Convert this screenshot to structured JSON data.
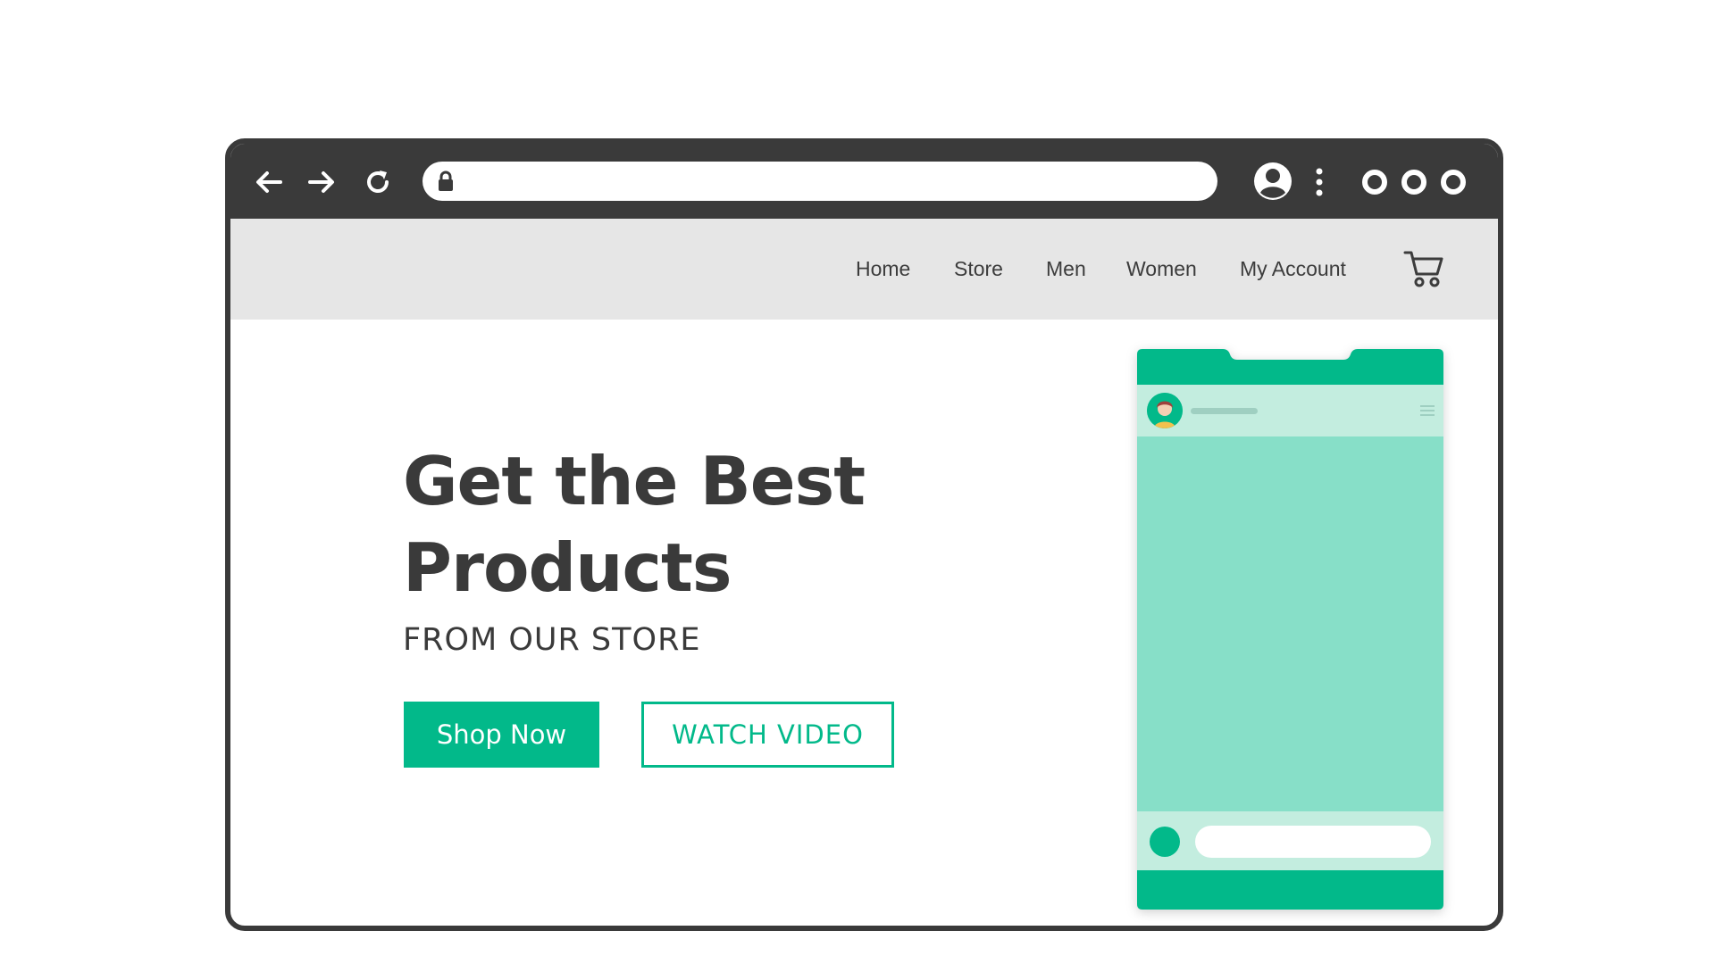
{
  "browser": {
    "toolbar": {
      "back_icon": "arrow-left-icon",
      "forward_icon": "arrow-right-icon",
      "reload_icon": "reload-icon",
      "address_bar": {
        "value": "",
        "lock_icon": "lock-icon"
      },
      "profile_icon": "user-circle-icon",
      "menu_icon": "kebab-menu-icon",
      "window_controls": [
        "circle-icon",
        "circle-icon",
        "circle-icon"
      ]
    }
  },
  "site": {
    "nav": {
      "links": [
        "Home",
        "Store",
        "Men",
        "Women",
        "My Account"
      ],
      "cart_icon": "cart-icon"
    },
    "hero": {
      "title_line1": "Get the Best",
      "title_line2": "Products",
      "subtitle": "FROM OUR STORE",
      "primary_button": "Shop Now",
      "secondary_button": "WATCH VIDEO"
    },
    "phone_mockup": {
      "avatar_icon": "user-avatar-icon",
      "menu_icon": "hamburger-icon",
      "composer_value": ""
    }
  },
  "colors": {
    "accent": "#02b98a",
    "chrome": "#3a3a3a",
    "nav_bg": "#e6e6e6",
    "phone_screen": "#87dfc8",
    "phone_panel": "#c3eddf",
    "text": "#3a3a3a"
  }
}
